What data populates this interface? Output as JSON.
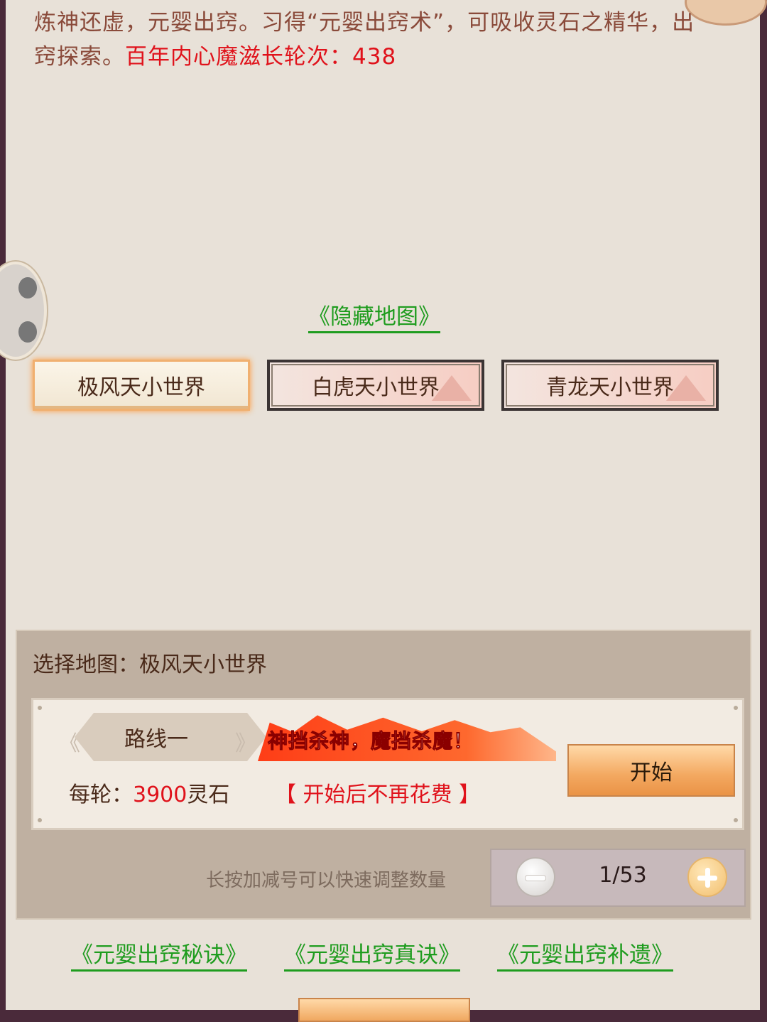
{
  "intro": {
    "text": "炼神还虚，元婴出窍。习得“元婴出窍术”，可吸收灵石之精华，出窍探索。",
    "highlight": "百年内心魔滋长轮次：438"
  },
  "hidden_map_link": "《隐藏地图》",
  "world_tabs": [
    {
      "label": "极风天小世界",
      "active": true
    },
    {
      "label": "白虎天小世界",
      "active": false
    },
    {
      "label": "青龙天小世界",
      "active": false
    }
  ],
  "panel": {
    "selected_map": "选择地图：极风天小世界",
    "route_label": "路线一",
    "slogan": "神挡杀神，魔挡杀魔！",
    "cost_label": "每轮：",
    "cost_value": "3900",
    "cost_unit": "灵石",
    "no_extra_cost": "【 开始后不再花费 】",
    "start_button": "开始",
    "hint": "长按加减号可以快速调整数量",
    "stepper_value": "1/53"
  },
  "bottom_links": [
    "《元婴出窍秘诀》",
    "《元婴出窍真诀》",
    "《元婴出窍补遗》"
  ],
  "colors": {
    "accent_red": "#e0121b",
    "link_green": "#1e9c1e",
    "text_brown": "#8a4a3a"
  }
}
